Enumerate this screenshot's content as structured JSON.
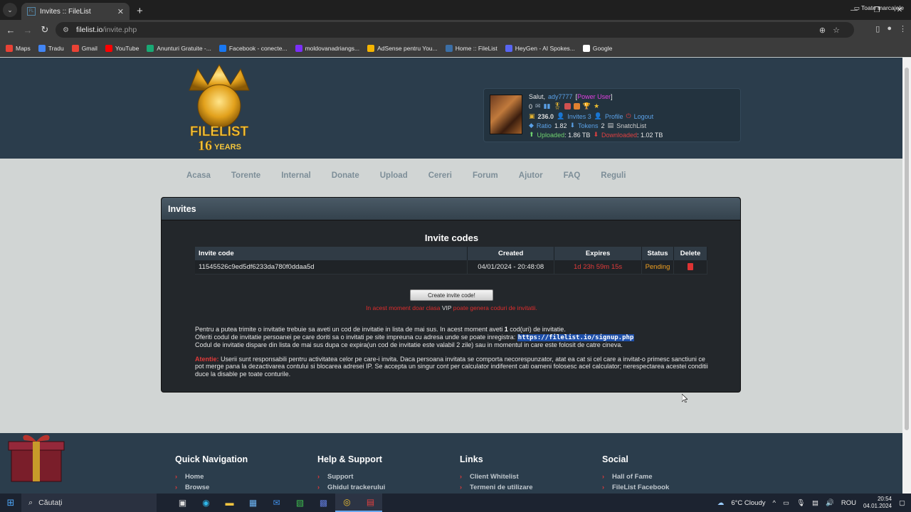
{
  "browser": {
    "tab_title": "Invites :: FileList",
    "tab_favicon": "FL",
    "url_host": "filelist.io",
    "url_path": "/invite.php",
    "bookmarks": [
      {
        "label": "Maps",
        "color": "#e94235"
      },
      {
        "label": "Tradu",
        "color": "#4285f4"
      },
      {
        "label": "Gmail",
        "color": "#ea4335"
      },
      {
        "label": "YouTube",
        "color": "#ff0000"
      },
      {
        "label": "Anunturi Gratuite -...",
        "color": "#19a974"
      },
      {
        "label": "Facebook - conecte...",
        "color": "#1877f2"
      },
      {
        "label": "moldovanadriangs...",
        "color": "#7b2ff7"
      },
      {
        "label": "AdSense pentru You...",
        "color": "#f4b400"
      },
      {
        "label": "Home :: FileList",
        "color": "#3b6ea5"
      },
      {
        "label": "HeyGen - AI Spokes...",
        "color": "#5865f2"
      },
      {
        "label": "Google",
        "color": "#ffffff"
      }
    ],
    "all_bookmarks": "Toate marcajele"
  },
  "user": {
    "greeting": "Salut,",
    "username": "ady7777",
    "class": "Power User",
    "messages": "0",
    "bonus": "236.0",
    "invites": "Invites 3",
    "profile": "Profile",
    "logout": "Logout",
    "ratio_label": "Ratio",
    "ratio": "1.82",
    "tokens_label": "Tokens",
    "tokens": "2",
    "snatchlist": "SnatchList",
    "uploaded_label": "Uploaded",
    "uploaded": ": 1.86 TB",
    "downloaded_label": "Downloaded",
    "downloaded": ": 1.02 TB"
  },
  "logo": {
    "line1": "FILELIST",
    "line2": "16",
    "line3": "YEARS"
  },
  "nav": [
    "Acasa",
    "Torente",
    "Internal",
    "Donate",
    "Upload",
    "Cereri",
    "Forum",
    "Ajutor",
    "FAQ",
    "Reguli"
  ],
  "panel": {
    "title": "Invites",
    "section_title": "Invite codes",
    "columns": [
      "Invite code",
      "Created",
      "Expires",
      "Status",
      "Delete"
    ],
    "rows": [
      {
        "code": "11545526c9ed5df6233da780f0ddaa5d",
        "created": "04/01/2024 - 20:48:08",
        "expires": "1d 23h 59m 15s",
        "status": "Pending"
      }
    ],
    "create_button": "Create invite code!",
    "vip_note_a": "In acest moment doar clasa",
    "vip_note_vip": "VIP",
    "vip_note_b": "poate genera coduri de invitatii.",
    "info1_a": "Pentru a putea trimite o invitatie trebuie sa aveti un cod de invitatie in lista de mai sus. In acest moment aveti",
    "info1_count": "1",
    "info1_b": "cod(uri) de invitatie.",
    "info2": "Oferiti codul de invitatie persoanei pe care doriti sa o invitati pe site impreuna cu adresa unde se poate inregistra:",
    "signup_link": "https://filelist.io/signup.php",
    "info3": "Codul de invitatie dispare din lista de mai sus dupa ce expira(un cod de invitatie este valabil 2 zile) sau in momentul in care este folosit de catre cineva.",
    "warning_label": "Atentie:",
    "warning_text": "Userii sunt responsabili pentru activitatea celor pe care-i invita. Daca persoana invitata se comporta necorespunzator, atat ea cat si cel care a invitat-o primesc sanctiuni ce pot merge pana la dezactivarea contului si blocarea adresei IP. Se accepta un singur cont per calculator indiferent cati oameni folosesc acel calculator; nerespectarea acestei conditii duce la disable pe toate conturile."
  },
  "footer": {
    "quick_nav": {
      "title": "Quick Navigation",
      "links": [
        "Home",
        "Browse"
      ]
    },
    "help": {
      "title": "Help & Support",
      "links": [
        "Support",
        "Ghidul trackerului"
      ]
    },
    "links": {
      "title": "Links",
      "links": [
        "Client Whitelist",
        "Termeni de utilizare"
      ]
    },
    "social": {
      "title": "Social",
      "links": [
        "Hall of Fame",
        "FileList Facebook"
      ]
    }
  },
  "taskbar": {
    "search_placeholder": "Căutați",
    "weather": "6°C  Cloudy",
    "lang": "ROU",
    "time": "20:54",
    "date": "04.01.2024"
  }
}
